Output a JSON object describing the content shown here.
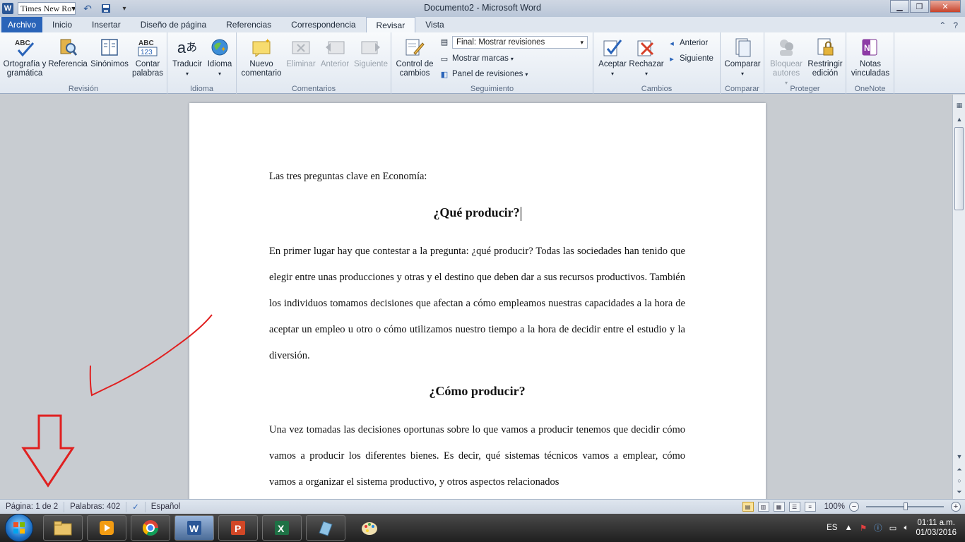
{
  "titlebar": {
    "font_name": "Times New Ro",
    "title": "Documento2 - Microsoft Word",
    "logo_letter": "W"
  },
  "tabs": [
    {
      "label": "Archivo"
    },
    {
      "label": "Inicio"
    },
    {
      "label": "Insertar"
    },
    {
      "label": "Diseño de página"
    },
    {
      "label": "Referencias"
    },
    {
      "label": "Correspondencia"
    },
    {
      "label": "Revisar"
    },
    {
      "label": "Vista"
    }
  ],
  "ribbon": {
    "revision": {
      "label": "Revisión",
      "ortografia": "Ortografía y gramática",
      "referencia": "Referencia",
      "sinonimos": "Sinónimos",
      "contar": "Contar palabras"
    },
    "idioma": {
      "label": "Idioma",
      "traducir": "Traducir",
      "idioma": "Idioma"
    },
    "comentarios": {
      "label": "Comentarios",
      "nuevo": "Nuevo comentario",
      "eliminar": "Eliminar",
      "anterior": "Anterior",
      "siguiente": "Siguiente"
    },
    "seguimiento": {
      "label": "Seguimiento",
      "control": "Control de cambios",
      "combo": "Final: Mostrar revisiones",
      "mostrar_marcas": "Mostrar marcas",
      "panel": "Panel de revisiones"
    },
    "cambios": {
      "label": "Cambios",
      "aceptar": "Aceptar",
      "rechazar": "Rechazar",
      "anterior": "Anterior",
      "siguiente": "Siguiente"
    },
    "comparar": {
      "label": "Comparar",
      "comparar": "Comparar"
    },
    "proteger": {
      "label": "Proteger",
      "bloquear": "Bloquear autores",
      "restringir": "Restringir edición"
    },
    "onenote": {
      "label": "OneNote",
      "notas": "Notas vinculadas"
    }
  },
  "document": {
    "intro": "Las tres preguntas clave en Economía:",
    "heading1": "¿Qué producir?",
    "para1": "En primer lugar hay que contestar a la pregunta: ¿qué producir? Todas las sociedades han tenido que elegir entre unas producciones y otras y el destino que deben dar a sus recursos productivos. También los individuos tomamos decisiones que afectan a cómo empleamos nuestras capacidades a la hora de aceptar un empleo u otro o cómo utilizamos nuestro tiempo a la hora de decidir entre el estudio y la diversión.",
    "heading2": "¿Cómo producir?",
    "para2": "Una vez tomadas las decisiones oportunas sobre lo que vamos a producir tenemos que decidir cómo vamos a producir los diferentes bienes. Es decir, qué sistemas técnicos vamos a emplear, cómo vamos a organizar el sistema productivo, y otros aspectos relacionados"
  },
  "statusbar": {
    "page": "Página: 1 de 2",
    "words": "Palabras: 402",
    "language": "Español",
    "zoom": "100%"
  },
  "taskbar": {
    "lang": "ES",
    "time": "01:11 a.m.",
    "date": "01/03/2016"
  },
  "colors": {
    "file_tab": "#2a64b9",
    "annotation": "#e02020"
  }
}
